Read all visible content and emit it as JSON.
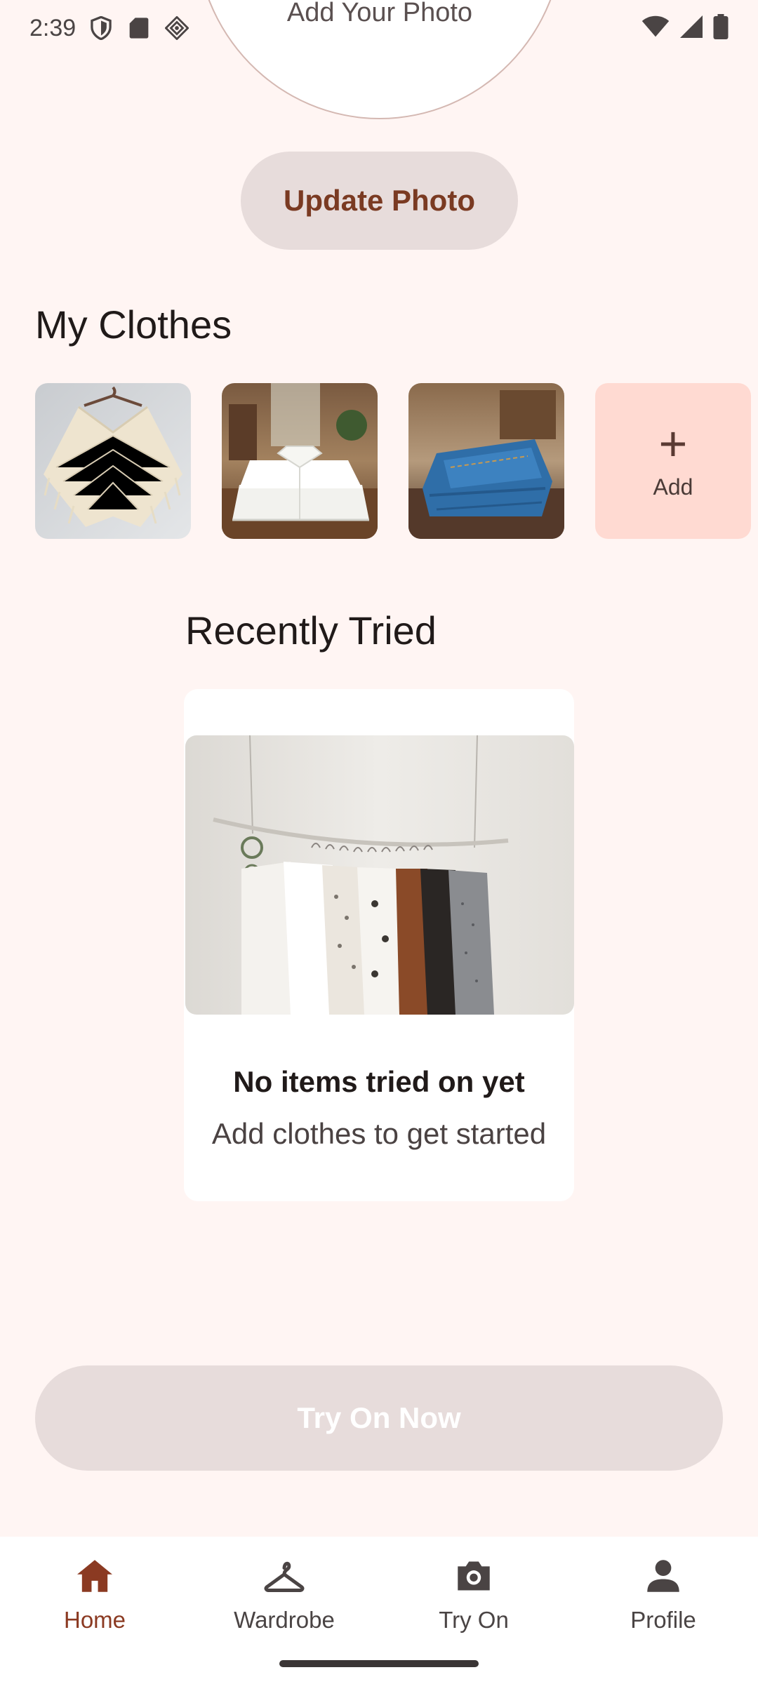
{
  "status_bar": {
    "time": "2:39",
    "icons_left": [
      "shield-icon",
      "sd-card-icon",
      "diamond-icon"
    ],
    "icons_right": [
      "wifi-icon",
      "signal-icon",
      "battery-icon"
    ]
  },
  "profile_photo": {
    "label": "Add Your Photo",
    "update_button": "Update Photo"
  },
  "my_clothes": {
    "title": "My Clothes",
    "items": [
      {
        "name": "cream knit poncho"
      },
      {
        "name": "white folded shirt"
      },
      {
        "name": "blue folded jeans"
      }
    ],
    "add_label": "Add",
    "add_symbol": "+"
  },
  "recently_tried": {
    "title": "Recently Tried",
    "empty_heading": "No items tried on yet",
    "empty_sub": "Add clothes to get started"
  },
  "try_on_button": "Try On Now",
  "nav": {
    "items": [
      {
        "label": "Home",
        "icon": "home-icon",
        "active": true
      },
      {
        "label": "Wardrobe",
        "icon": "hanger-icon",
        "active": false
      },
      {
        "label": "Try On",
        "icon": "camera-icon",
        "active": false
      },
      {
        "label": "Profile",
        "icon": "person-icon",
        "active": false
      }
    ]
  },
  "colors": {
    "background": "#fff5f3",
    "accent": "#8b3a22",
    "button_muted": "#e7dcdb",
    "add_tile": "#ffdad2"
  }
}
